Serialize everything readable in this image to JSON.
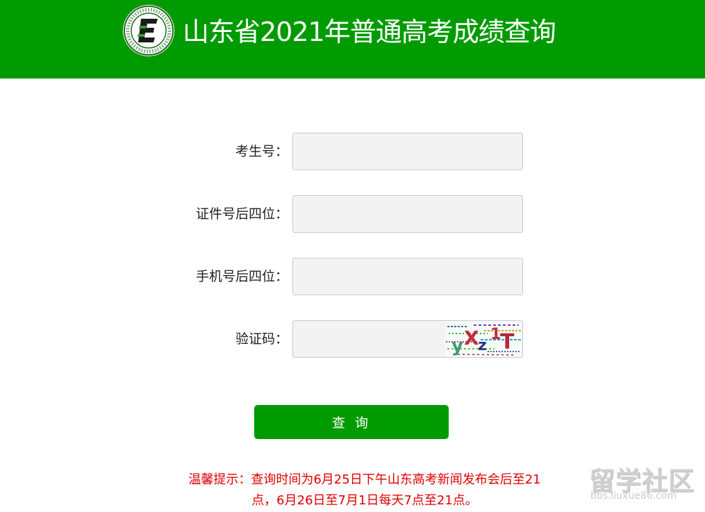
{
  "header": {
    "title": "山东省2021年普通高考成绩查询",
    "background_color": "#009b00",
    "logo_icon": "exam-institute-logo-icon",
    "logo_letter": "E",
    "logo_ring_text": "Shandong Education Admissions & Examinations"
  },
  "form": {
    "exam_number_label": "考生号：",
    "id_last4_label": "证件号后四位：",
    "phone_last4_label": "手机号后四位：",
    "captcha_label": "验证码：",
    "exam_number_value": "",
    "id_last4_value": "",
    "phone_last4_value": "",
    "captcha_value": "",
    "captcha_image_text": "yXz1T"
  },
  "submit_label": "查 询",
  "notice": {
    "line1": "温馨提示：查询时间为6月25日下午山东高考新闻发布会后至21",
    "line2": "点，6月26日至7月1日每天7点至21点。"
  },
  "watermark": {
    "title": "留学社区",
    "url": "bbs.liuxue86.com"
  },
  "colors": {
    "accent": "#009b00",
    "notice": "#e00000"
  }
}
